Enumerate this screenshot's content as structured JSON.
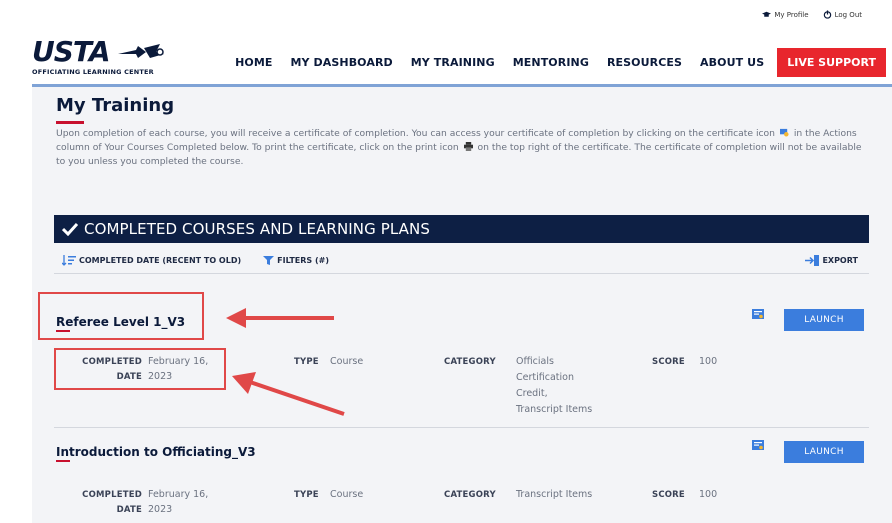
{
  "utility": {
    "profile": "My Profile",
    "logout": "Log Out"
  },
  "logo": {
    "wordmark": "USTA",
    "subtitle": "OFFICIATING LEARNING CENTER"
  },
  "nav": {
    "items": [
      "HOME",
      "MY DASHBOARD",
      "MY TRAINING",
      "MENTORING",
      "RESOURCES",
      "ABOUT US"
    ],
    "live_support": "LIVE SUPPORT"
  },
  "page": {
    "title": "My Training",
    "intro_1": "Upon completion of each course, you will receive a certificate of completion. You can access your certificate of completion by clicking on the certificate icon",
    "intro_2": "in the Actions column of Your Courses Completed below. To print the certificate, click on the print icon",
    "intro_3": "on the top right of the certificate. The certificate of completion will not be available to you unless you completed the course."
  },
  "section": {
    "title": "COMPLETED COURSES AND LEARNING PLANS"
  },
  "toolbar": {
    "sort": "COMPLETED DATE (RECENT TO OLD)",
    "filters": "FILTERS (#)",
    "export": "EXPORT"
  },
  "labels": {
    "completed": "COMPLETED",
    "date": "DATE",
    "type": "TYPE",
    "category": "CATEGORY",
    "score": "SCORE",
    "launch": "LAUNCH"
  },
  "courses": [
    {
      "title": "Referee Level 1_V3",
      "completed_date_1": "February 16,",
      "completed_date_2": "2023",
      "type": "Course",
      "category_lines": [
        "Officials",
        "Certification",
        "Credit,",
        "Transcript Items"
      ],
      "score": "100"
    },
    {
      "title": "Introduction to Officiating_V3",
      "completed_date_1": "February 16,",
      "completed_date_2": "2023",
      "type": "Course",
      "category_lines": [
        "Transcript Items"
      ],
      "score": "100"
    }
  ],
  "colors": {
    "accent_red": "#e8262d",
    "navy": "#0d1f44",
    "launch_blue": "#3b7ddd",
    "annotation": "#e04848"
  }
}
